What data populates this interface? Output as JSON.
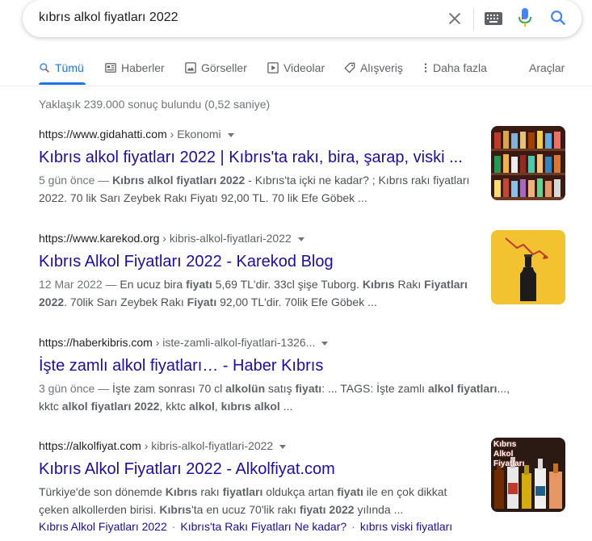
{
  "search": {
    "query": "kıbrıs alkol fiyatları 2022"
  },
  "tabs": [
    {
      "label": "Tümü"
    },
    {
      "label": "Haberler"
    },
    {
      "label": "Görseller"
    },
    {
      "label": "Videolar"
    },
    {
      "label": "Alışveriş"
    },
    {
      "label": "Daha fazla"
    }
  ],
  "tools_label": "Araçlar",
  "stats": "Yaklaşık 239.000 sonuç bulundu (0,52 saniye)",
  "results": [
    {
      "domain": "https://www.gidahatti.com",
      "path": " › Ekonomi",
      "title": "Kıbrıs alkol fiyatları 2022 | Kıbrıs'ta rakı, bira, şarap, viski ...",
      "date": "5 gün önce —",
      "s1": " ",
      "b1": "Kıbrıs alkol fiyatları 2022",
      "s2": " - Kıbrıs'ta içki ne kadar? ; Kıbrıs rakı fiyatları 2022. 70 lik Sarı Zeybek Rakı Fiyatı 92,00 TL. 70 lik Efe Göbek ..."
    },
    {
      "domain": "https://www.karekod.org",
      "path": " › kibris-alkol-fiyatlari-2022",
      "title": "Kıbrıs Alkol Fiyatları 2022 - Karekod Blog",
      "date": "12 Mar 2022 —",
      "s1": " En ucuz bira ",
      "b1": "fiyatı",
      "s2": " 5,69 TL'dir. 33cl şişe Tuborg. ",
      "b2": "Kıbrıs",
      "s3": " Rakı ",
      "b3": "Fiyatları 2022",
      "s4": ". 70lik Sarı Zeybek Rakı ",
      "b4": "Fiyatı",
      "s5": " 92,00 TL'dir. 70lik Efe Göbek ..."
    },
    {
      "domain": "https://haberkibris.com",
      "path": " › iste-zamli-alkol-fiyatlari-1326...",
      "title": "İşte zamlı alkol fiyatları… - Haber Kıbrıs",
      "date": "3 gün önce —",
      "s1": " İşte zam sonrası 70 cl ",
      "b1": "alkolün",
      "s2": " satış ",
      "b2": "fiyatı",
      "s3": ": ... TAGS: İşte zamlı ",
      "b3": "alkol fiyatları",
      "s4": "..., kktc ",
      "b4": "alkol fiyatları 2022",
      "s5": ", kktc ",
      "b5": "alkol",
      "s6": ", ",
      "b6": "kıbrıs alkol",
      "s7": " ..."
    },
    {
      "domain": "https://alkolfiyat.com",
      "path": " › kibris-alkol-fiyatlari-2022",
      "title": "Kıbrıs Alkol Fiyatları 2022 - Alkolfiyat.com",
      "s1": "Türkiye'de son dönemde ",
      "b1": "Kıbrıs",
      "s2": " rakı ",
      "b2": "fiyatları",
      "s3": " oldukça artan ",
      "b3": "fiyatı",
      "s4": " ile en çok dikkat çeken alkollerden birisi. ",
      "b4": "Kıbrıs",
      "s5": "'ta en ucuz 70'lik rakı ",
      "b5": "fiyatı 2022",
      "s6": " yılında ...",
      "sitelinks": [
        "Kıbrıs Alkol Fiyatları 2022",
        "Kıbrıs'ta Rakı Fiyatları Ne kadar?",
        "kıbrıs viski fiyatları"
      ],
      "thumb_text": "Kıbrıs\nAlkol\nFiyatları"
    }
  ],
  "colors": {
    "link": "#1a0dab",
    "accent": "#1a73e8",
    "text_muted": "#70757a"
  }
}
